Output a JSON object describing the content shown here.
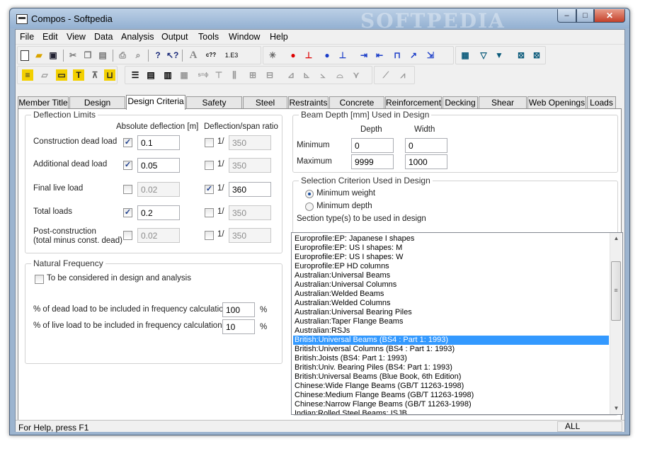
{
  "window": {
    "title": "Compos - Softpedia",
    "watermark": "SOFTPEDIA",
    "minimize": "‒",
    "maximize": "□",
    "close": "✕"
  },
  "menu": [
    "File",
    "Edit",
    "View",
    "Data",
    "Analysis",
    "Output",
    "Tools",
    "Window",
    "Help"
  ],
  "toolbar1": {
    "groupA": [
      "new-file-icon",
      "open-folder-icon",
      "save-icon"
    ],
    "groupB": [
      "cut-icon",
      "copy-icon",
      "paste-icon"
    ],
    "groupC": [
      "print-icon",
      "print-preview-icon"
    ],
    "groupD": [
      "help-icon",
      "context-help-icon"
    ],
    "groupE": [
      "font-icon",
      "units-icon",
      "number-format-icon"
    ],
    "groupF": [
      "wizard-icon",
      "node-red-icon",
      "support-red-icon",
      "node-blue-icon",
      "support-blue-icon",
      "add-load-icon",
      "add-tension-icon",
      "beam-span-icon",
      "point-arrow-icon",
      "move-arrow-icon"
    ],
    "groupG": [
      "table-icon",
      "filter-icon",
      "filter-table-icon",
      "clear-filter-icon",
      "clear-filter-table-icon"
    ],
    "font_label": "A",
    "units_label": "c??",
    "number_label": "1.E3"
  },
  "tabs": [
    "Member Title",
    "Design Options",
    "Design Criteria",
    "Safety Factors",
    "Steel Beam",
    "Restraints",
    "Concrete Slab",
    "Reinforcement",
    "Decking",
    "Shear Studs",
    "Web Openings",
    "Loads"
  ],
  "active_tab": "Design Criteria",
  "deflection": {
    "group_label": "Deflection Limits",
    "col_abs": "Absolute deflection [m]",
    "col_ratio": "Deflection/span ratio",
    "ratio_prefix": "1/",
    "rows": [
      {
        "label": "Construction dead load",
        "abs_checked": "✓",
        "abs_value": "0.1",
        "ratio_checked": "",
        "ratio_value": "350"
      },
      {
        "label": "Additional dead load",
        "abs_checked": "✓",
        "abs_value": "0.05",
        "ratio_checked": "",
        "ratio_value": "350"
      },
      {
        "label": "Final live load",
        "abs_checked": "",
        "abs_value": "0.02",
        "ratio_checked": "✓",
        "ratio_value": "360"
      },
      {
        "label": "Total loads",
        "abs_checked": "✓",
        "abs_value": "0.2",
        "ratio_checked": "",
        "ratio_value": "350"
      },
      {
        "label": "Post-construction",
        "label2": "(total minus const. dead)",
        "abs_checked": "",
        "abs_value": "0.02",
        "ratio_checked": "",
        "ratio_value": "350"
      }
    ]
  },
  "frequency": {
    "group_label": "Natural Frequency",
    "consider_label": "To be considered in design and analysis",
    "consider_checked": "",
    "dead_label": "% of dead load to be included in frequency calculation",
    "dead_value": "100",
    "live_label": "% of live load to be included in frequency calculation",
    "live_value": "10",
    "unit": "%"
  },
  "beam_depth": {
    "group_label": "Beam Depth [mm] Used in Design",
    "col_depth": "Depth",
    "col_width": "Width",
    "min_label": "Minimum",
    "min_depth": "0",
    "min_width": "0",
    "max_label": "Maximum",
    "max_depth": "9999",
    "max_width": "1000"
  },
  "selection": {
    "group_label": "Selection Criterion Used in Design",
    "opt_weight": "Minimum weight",
    "opt_depth": "Minimum depth",
    "section_label": "Section type(s) to be used in design",
    "items": [
      "Europrofile:EP: Japanese I shapes",
      "Europrofile:EP: US I shapes: M",
      "Europrofile:EP: US I shapes: W",
      "Europrofile:EP HD columns",
      "Australian:Universal Beams",
      "Australian:Universal Columns",
      "Australian:Welded Beams",
      "Australian:Welded Columns",
      "Australian:Universal Bearing Piles",
      "Australian:Taper Flange Beams",
      "Australian:RSJs",
      "British:Universal Beams (BS4 : Part 1: 1993)",
      "British:Universal Columns (BS4 : Part 1: 1993)",
      "British:Joists (BS4: Part 1: 1993)",
      "British:Univ. Bearing Piles (BS4: Part 1: 1993)",
      "British:Universal Beams (Blue Book, 6th Edition)",
      "Chinese:Wide Flange Beams (GB/T 11263-1998)",
      "Chinese:Medium Flange Beams (GB/T 11263-1998)",
      "Chinese:Narrow Flange Beams (GB/T 11263-1998)",
      "Indian:Rolled Steel Beams: ISJB"
    ],
    "selected_index": 11,
    "scroll_up": "▲",
    "scroll_down": "▼",
    "thumb_grip": "≡"
  },
  "status": {
    "text": "For Help, press F1",
    "panel": "ALL"
  }
}
